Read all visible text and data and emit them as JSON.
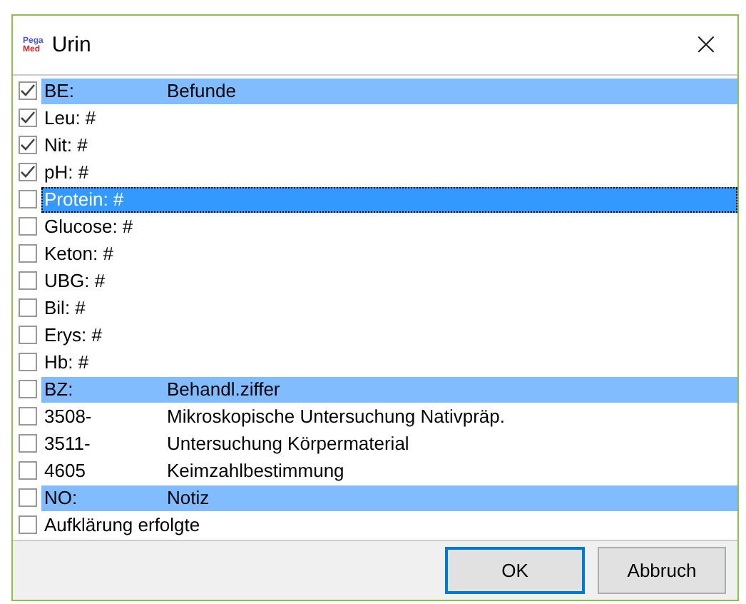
{
  "window": {
    "title": "Urin",
    "logo": [
      "Pega",
      "Med"
    ],
    "close": "×"
  },
  "rows": [
    {
      "kind": "header",
      "label": "BE:",
      "description": "Befunde",
      "checked": true,
      "selected": false
    },
    {
      "kind": "item",
      "label": "Leu: #",
      "checked": true,
      "selected": false
    },
    {
      "kind": "item",
      "label": "Nit: #",
      "checked": true,
      "selected": false
    },
    {
      "kind": "item",
      "label": "pH: #",
      "checked": true,
      "selected": false
    },
    {
      "kind": "item",
      "label": "Protein: #",
      "checked": false,
      "selected": true
    },
    {
      "kind": "item",
      "label": "Glucose: #",
      "checked": false,
      "selected": false
    },
    {
      "kind": "item",
      "label": "Keton: #",
      "checked": false,
      "selected": false
    },
    {
      "kind": "item",
      "label": "UBG: #",
      "checked": false,
      "selected": false
    },
    {
      "kind": "item",
      "label": "Bil: #",
      "checked": false,
      "selected": false
    },
    {
      "kind": "item",
      "label": "Erys: #",
      "checked": false,
      "selected": false
    },
    {
      "kind": "item",
      "label": "Hb: #",
      "checked": false,
      "selected": false
    },
    {
      "kind": "header",
      "label": "BZ:",
      "description": "Behandl.ziffer",
      "checked": false,
      "selected": false
    },
    {
      "kind": "item",
      "label": "3508-",
      "description": "Mikroskopische Untersuchung Nativpräp.",
      "checked": false,
      "selected": false
    },
    {
      "kind": "item",
      "label": "3511-",
      "description": "Untersuchung Körpermaterial",
      "checked": false,
      "selected": false
    },
    {
      "kind": "item",
      "label": "4605",
      "description": "Keimzahlbestimmung",
      "checked": false,
      "selected": false
    },
    {
      "kind": "header",
      "label": "NO:",
      "description": "Notiz",
      "checked": false,
      "selected": false
    },
    {
      "kind": "item",
      "label": "Aufklärung erfolgte",
      "checked": false,
      "selected": false
    }
  ],
  "buttons": [
    {
      "label": "OK",
      "default": true
    },
    {
      "label": "Abbruch",
      "default": false
    }
  ]
}
